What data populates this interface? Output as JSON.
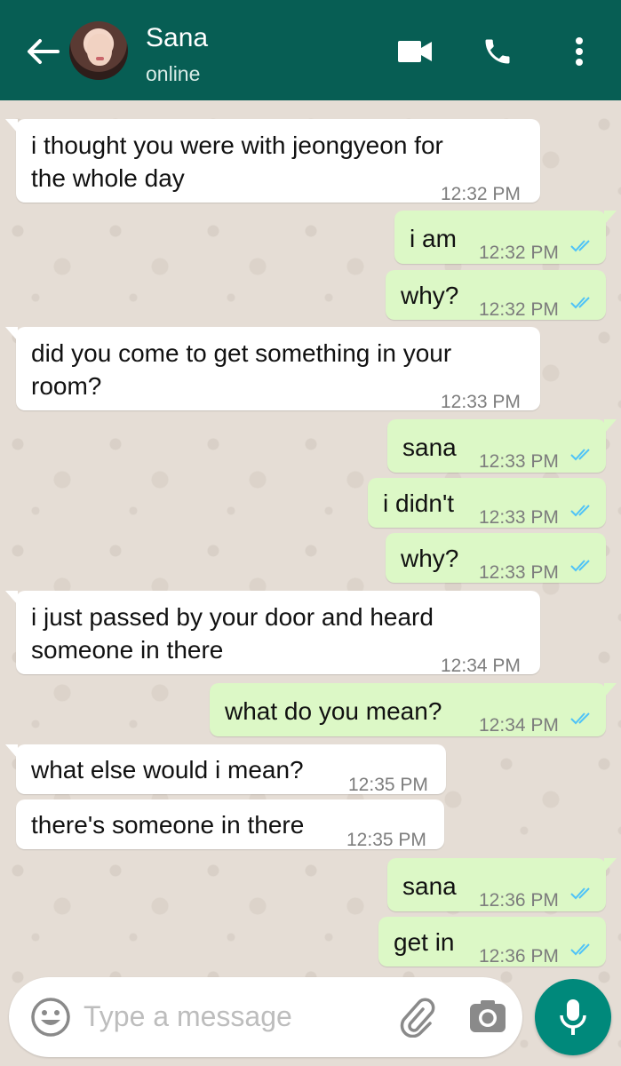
{
  "header": {
    "contact_name": "Sana",
    "status": "online",
    "icons": [
      "back-arrow-icon",
      "video-call-icon",
      "voice-call-icon",
      "more-options-icon"
    ],
    "color": "#075e54"
  },
  "messages": [
    {
      "dir": "in",
      "text": "i thought you were with jeongyeon for\nthe whole day",
      "time": "12:32 PM"
    },
    {
      "dir": "out",
      "text": "i am",
      "time": "12:32 PM",
      "status": "read"
    },
    {
      "dir": "out",
      "text": "why?",
      "time": "12:32 PM",
      "status": "read"
    },
    {
      "dir": "in",
      "text": "did you come to get something in your\nroom?",
      "time": "12:33 PM"
    },
    {
      "dir": "out",
      "text": "sana",
      "time": "12:33 PM",
      "status": "read"
    },
    {
      "dir": "out",
      "text": "i didn't",
      "time": "12:33 PM",
      "status": "read"
    },
    {
      "dir": "out",
      "text": "why?",
      "time": "12:33 PM",
      "status": "read"
    },
    {
      "dir": "in",
      "text": "i just passed by your door and heard\nsomeone in there",
      "time": "12:34 PM"
    },
    {
      "dir": "out",
      "text": "what do you mean?",
      "time": "12:34 PM",
      "status": "read"
    },
    {
      "dir": "in",
      "text": "what else would i mean?",
      "time": "12:35 PM"
    },
    {
      "dir": "in",
      "text": "there's someone in there",
      "time": "12:35 PM"
    },
    {
      "dir": "out",
      "text": "sana",
      "time": "12:36 PM",
      "status": "read"
    },
    {
      "dir": "out",
      "text": "get in",
      "time": "12:36 PM",
      "status": "read"
    }
  ],
  "composer": {
    "placeholder": "Type a message",
    "icons": [
      "emoji-icon",
      "attach-icon",
      "camera-icon",
      "mic-icon"
    ]
  },
  "colors": {
    "incoming_bubble": "#ffffff",
    "outgoing_bubble": "#dcf8c6",
    "read_tick": "#4fc3f7",
    "mic_button": "#00897b"
  }
}
